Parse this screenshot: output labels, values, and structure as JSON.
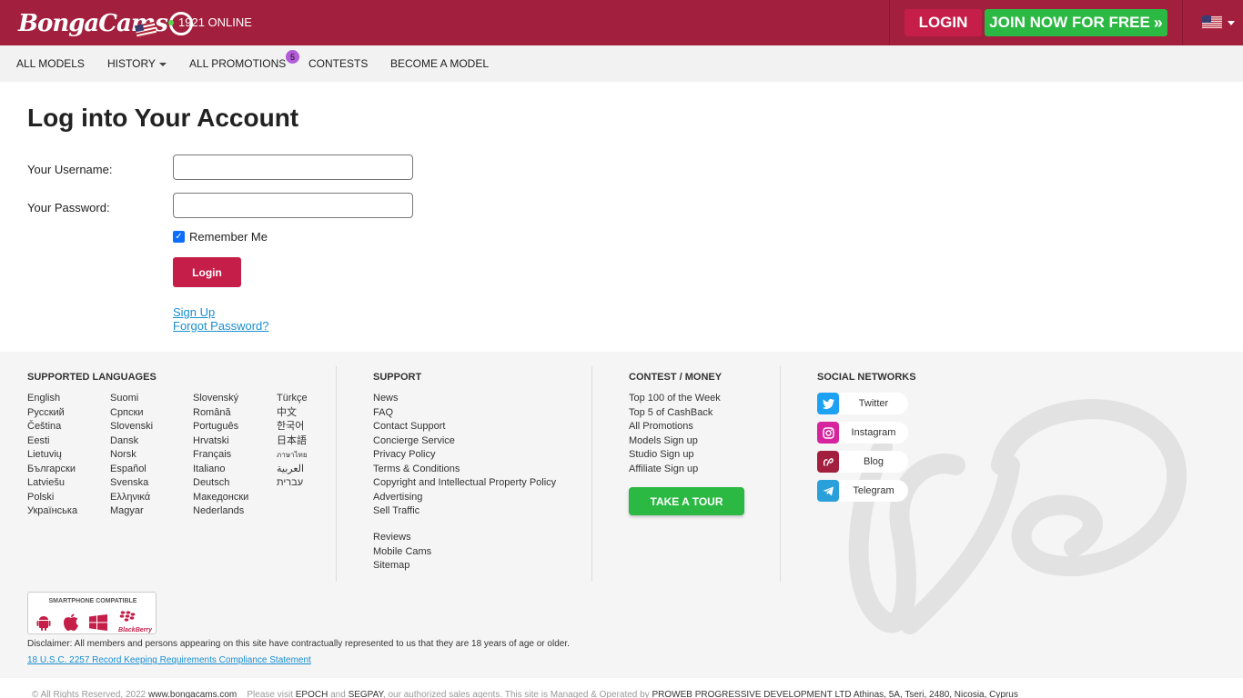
{
  "header": {
    "logo_text": "BongaCams",
    "online_count": "1921 ONLINE",
    "login_label": "LOGIN",
    "join_label": "JOIN NOW FOR FREE",
    "join_chevron": "»"
  },
  "nav": {
    "items": [
      "ALL MODELS",
      "HISTORY",
      "ALL PROMOTIONS",
      "CONTESTS",
      "BECOME A MODEL"
    ],
    "promotions_badge": "5"
  },
  "login": {
    "title": "Log into Your Account",
    "username_label": "Your Username:",
    "password_label": "Your Password:",
    "username_value": "",
    "password_value": "",
    "remember_label": "Remember Me",
    "remember_checked": true,
    "submit_label": "Login",
    "signup_link": "Sign Up",
    "forgot_link": "Forgot Password?"
  },
  "footer": {
    "languages_heading": "SUPPORTED LANGUAGES",
    "languages": [
      [
        "English",
        "Русский",
        "Čeština",
        "Eesti",
        "Lietuvių",
        "Български",
        "Latviešu",
        "Polski",
        "Українська"
      ],
      [
        "Suomi",
        "Српски",
        "Slovenski",
        "Dansk",
        "Norsk",
        "Español",
        "Svenska",
        "Ελληνικά",
        "Magyar"
      ],
      [
        "Slovenský",
        "Română",
        "Português",
        "Hrvatski",
        "Français",
        "Italiano",
        "Deutsch",
        "Македонски",
        "Nederlands"
      ],
      [
        "Türkçe",
        "中文",
        "한국어",
        "日本語",
        "ภาษาไทย",
        "العربية",
        "עברית"
      ]
    ],
    "support_heading": "SUPPORT",
    "support_links": [
      "News",
      "FAQ",
      "Contact Support",
      "Concierge Service",
      "Privacy Policy",
      "Terms & Conditions",
      "Copyright and Intellectual Property Policy",
      "Advertising",
      "Sell Traffic"
    ],
    "support_links_2": [
      "Reviews",
      "Mobile Cams",
      "Sitemap"
    ],
    "contest_heading": "CONTEST / MONEY",
    "contest_links": [
      "Top 100 of the Week",
      "Top 5 of CashBack",
      "All Promotions",
      "Models Sign up",
      "Studio Sign up",
      "Affiliate Sign up"
    ],
    "tour_label": "TAKE A TOUR",
    "social_heading": "SOCIAL NETWORKS",
    "social": [
      {
        "label": "Twitter",
        "icon": "twitter-icon",
        "color": "#1da1f2"
      },
      {
        "label": "Instagram",
        "icon": "instagram-icon",
        "color": "#d6249f"
      },
      {
        "label": "Blog",
        "icon": "blog-icon",
        "color": "#a21f3e"
      },
      {
        "label": "Telegram",
        "icon": "telegram-icon",
        "color": "#2aa0da"
      }
    ],
    "smartphone_label": "SMARTPHONE COMPATIBLE",
    "blackberry_label": "BlackBerry",
    "disclaimer": "Disclaimer: All members and persons appearing on this site have contractually represented to us that they are 18 years of age or older.",
    "usc_link": "18 U.S.C. 2257 Record Keeping Requirements Compliance Statement",
    "bottom": {
      "rights": "© All Rights Reserved, 2022",
      "site": "www.bongacams.com",
      "visit": "Please visit",
      "epoch": "EPOCH",
      "and": "and",
      "segpay": "SEGPAY",
      "agents": ", our authorized sales agents. This site is Managed & Operated by",
      "company": "PROWEB PROGRESSIVE DEVELOPMENT LTD Athinas, 5A, Tseri, 2480, Nicosia, Cyprus"
    }
  },
  "colors": {
    "brand": "#a21f3e",
    "accent_red": "#c41e49",
    "green": "#2bb843",
    "link": "#1a8ed1"
  }
}
